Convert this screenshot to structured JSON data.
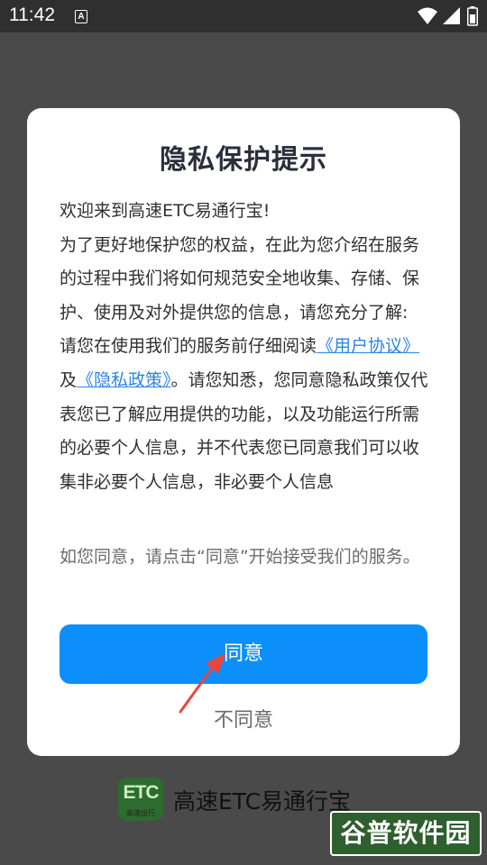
{
  "status_bar": {
    "time": "11:42",
    "notification_icon": "a-icon",
    "icons": [
      "wifi-icon",
      "signal-icon",
      "battery-icon"
    ]
  },
  "dialog": {
    "title": "隐私保护提示",
    "paragraphs": {
      "p1": "欢迎来到高速ETC易通行宝!",
      "p2": "为了更好地保护您的权益，在此为您介绍在服务的过程中我们将如何规范安全地收集、存储、保护、使用及对外提供您的信息，请您充分了解:",
      "p3_pre": "请您在使用我们的服务前仔细阅读",
      "link_user_agreement": "《用户协议》",
      "p3_and": "及",
      "link_privacy_policy": "《隐私政策》",
      "p3_post": "。请您知悉，您同意隐私政策仅代表您已了解应用提供的功能，以及功能运行所需的必要个人信息，并不代表您已同意我们可以收集非必要个人信息，非必要个人信息"
    },
    "notice": "如您同意，请点击“同意”开始接受我们的服务。",
    "agree_label": "同意",
    "disagree_label": "不同意"
  },
  "footer": {
    "logo_text": "ETC",
    "logo_subtext": "高速出行",
    "app_name": "高速ETC易通行宝"
  },
  "watermark": {
    "text": "谷普软件园"
  },
  "colors": {
    "accent": "#0d8ffb",
    "link": "#2b85e4",
    "overlay": "#4a4a4a",
    "annotation_arrow": "#e8453c"
  }
}
